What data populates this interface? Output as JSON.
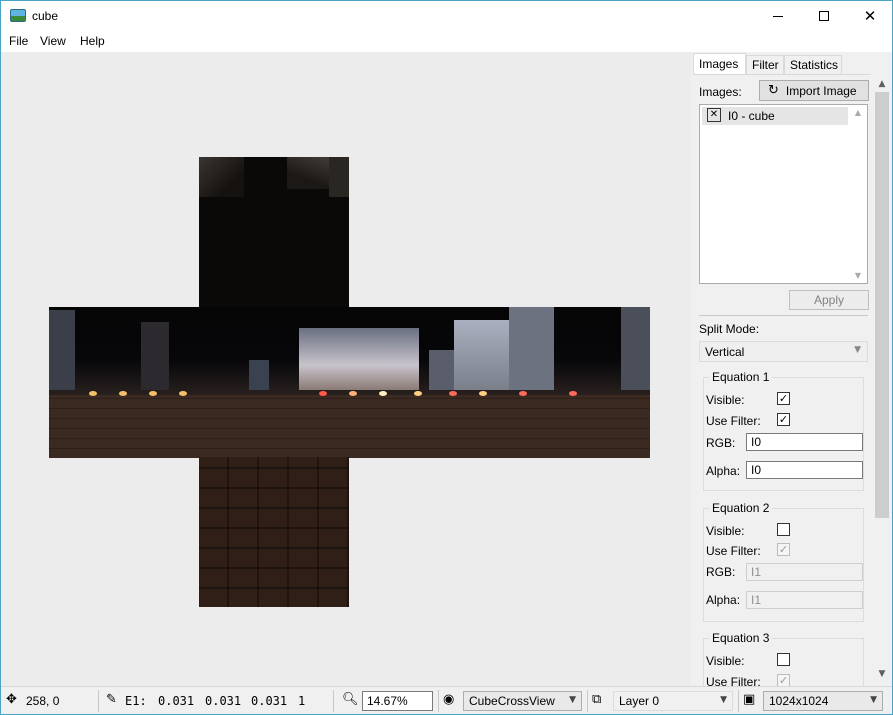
{
  "window": {
    "title": "cube"
  },
  "menu": [
    "File",
    "View",
    "Help"
  ],
  "panel": {
    "tabs": [
      "Images",
      "Filter",
      "Statistics"
    ],
    "images_label": "Images:",
    "import_button": "Import Image",
    "image_list": [
      {
        "close": "✕",
        "name": "I0 - cube"
      }
    ],
    "apply_button": "Apply",
    "split_mode_label": "Split Mode:",
    "split_mode_value": "Vertical",
    "equations": [
      {
        "title": "Equation 1",
        "visible_label": "Visible:",
        "visible": "✓",
        "use_filter_label": "Use Filter:",
        "use_filter": "✓",
        "rgb_label": "RGB:",
        "rgb": "I0",
        "alpha_label": "Alpha:",
        "alpha": "I0"
      },
      {
        "title": "Equation 2",
        "visible_label": "Visible:",
        "visible": "",
        "use_filter_label": "Use Filter:",
        "use_filter": "✓",
        "rgb_label": "RGB:",
        "rgb": "I1",
        "alpha_label": "Alpha:",
        "alpha": "I1"
      },
      {
        "title": "Equation 3",
        "visible_label": "Visible:",
        "visible": "",
        "use_filter_label": "Use Filter:",
        "use_filter": "✓"
      }
    ]
  },
  "status": {
    "cursor_pos": "258, 0",
    "pixel_label": "E1:",
    "pixel_r": "0.031",
    "pixel_g": "0.031",
    "pixel_b": "0.031",
    "pixel_a": "1",
    "zoom": "14.67%",
    "view_mode": "CubeCrossView",
    "layer": "Layer 0",
    "resolution": "1024x1024"
  },
  "colors": {
    "accent_border": "#4aa3c8",
    "canvas_bg": "#ececec",
    "panel_bg": "#f0f0f0"
  }
}
